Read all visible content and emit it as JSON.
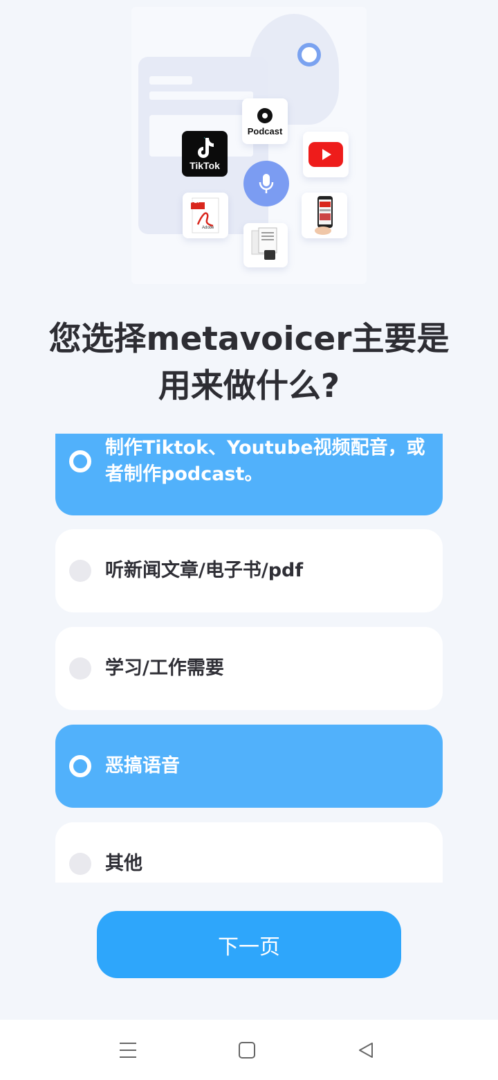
{
  "illustration": {
    "podcast_label": "Podcast",
    "tiktok_label": "TikTok",
    "pdf_label": "PDF",
    "adobe_label": "Adobe"
  },
  "question": {
    "line1": "您选择metavoicer主要是",
    "line2": "用来做什么?"
  },
  "options": [
    {
      "label": "制作Tiktok、Youtube视频配音，或者制作podcast。",
      "selected": true
    },
    {
      "label": "听新闻文章/电子书/pdf",
      "selected": false
    },
    {
      "label": "学习/工作需要",
      "selected": false
    },
    {
      "label": "恶搞语音",
      "selected": true
    },
    {
      "label": "其他",
      "selected": false
    }
  ],
  "next_button": {
    "label": "下一页"
  },
  "colors": {
    "background": "#f3f6fb",
    "selected_option": "#51b1fb",
    "primary_button": "#2ea6fb",
    "mic": "#7b9cf2"
  },
  "navbar": {
    "icons": [
      "menu-icon",
      "home-square-icon",
      "back-triangle-icon"
    ]
  }
}
